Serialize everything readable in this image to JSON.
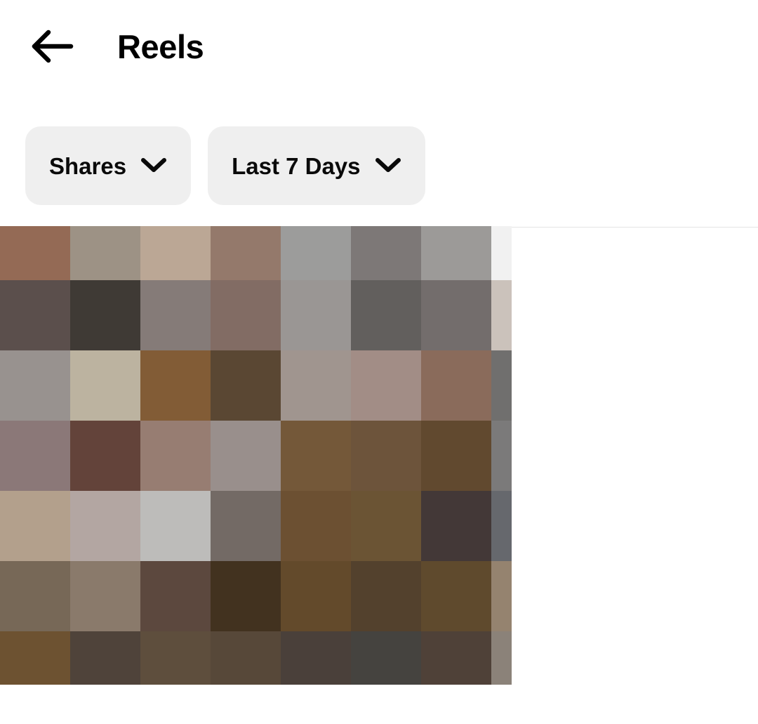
{
  "header": {
    "back_icon": "arrow-left-icon",
    "title": "Reels"
  },
  "filters": [
    {
      "label": "Shares",
      "icon": "chevron-down-icon"
    },
    {
      "label": "Last 7 Days",
      "icon": "chevron-down-icon"
    }
  ],
  "colors": {
    "pill_background": "#efefef",
    "text": "#0a0a0a",
    "divider": "#e4e4e4",
    "page_background": "#ffffff"
  },
  "media": {
    "name": "pixelated-reel-thumbnail",
    "columns": 8,
    "rows": 7,
    "pixels": [
      [
        "#946a55",
        "#9d9285",
        "#bba795",
        "#94796b",
        "#9c9c9b",
        "#7d7877",
        "#9c9a98",
        "#f1f1f1"
      ],
      [
        "#5b4f4c",
        "#3f3a35",
        "#857b78",
        "#826c64",
        "#9a9694",
        "#625f5d",
        "#736d6c",
        "#cbc2bb"
      ],
      [
        "#98928f",
        "#bcb3a0",
        "#825c36",
        "#5a4733",
        "#a0958f",
        "#a28d86",
        "#8a6b5b",
        "#706f6e"
      ],
      [
        "#8b7878",
        "#63433a",
        "#977d72",
        "#998f8c",
        "#745839",
        "#6d543b",
        "#61492f",
        "#7b7a7a"
      ],
      [
        "#b3a08c",
        "#b3a6a2",
        "#bdbcba",
        "#736a65",
        "#6c5032",
        "#6b5434",
        "#433837",
        "#66686d"
      ],
      [
        "#776857",
        "#8a7a6b",
        "#5c483e",
        "#42321f",
        "#634a2b",
        "#53412d",
        "#5f4a2d",
        "#95836f"
      ],
      [
        "#6d5231",
        "#4f433a",
        "#5e4e3d",
        "#574839",
        "#4a403a",
        "#45433f",
        "#4f4138",
        "#8b8279"
      ]
    ]
  }
}
